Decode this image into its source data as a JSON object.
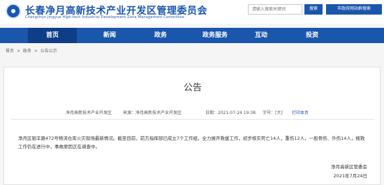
{
  "header": {
    "title": "长春净月高新技术产业开发区管理委员会",
    "subtitle": "Changchun Jingyue High-tech Industrial Development Zone Management Committee",
    "search_placeholder": "请输入搜索关键词",
    "search_label": "搜索",
    "mailbox_label": "市政府网站群搜索"
  },
  "nav": {
    "items": [
      {
        "label": "首页"
      },
      {
        "label": "新闻"
      },
      {
        "label": "政务"
      },
      {
        "label": "政务服务"
      },
      {
        "label": "互动"
      },
      {
        "label": "投资"
      }
    ],
    "active_color": "#0e3e88",
    "color": "#1b56ad"
  },
  "breadcrumb": {
    "items": [
      "首页",
      ">",
      "政务",
      ">",
      "公告公示"
    ]
  },
  "article": {
    "title": "公告",
    "source_left": "净月高新技术产业开发区",
    "source_label": "来源：净月高新技术产业开发区",
    "date_label": "日期：2021-07-24 19:38",
    "font_label": "字号：[大]",
    "print_label": "打印本页",
    "body": "净月区银丰路472号物流仓库火灾现场最新情况。截至目前，前方指挥部已成立7个工作组，全力展开救援工作，初步核实死亡14人，重伤12人，一般骨伤、外伤14人，搜救工作仍在进行中，事故原因正在调查中。",
    "signature_org": "净月高新区管委会",
    "signature_date": "2021年7月24日"
  }
}
